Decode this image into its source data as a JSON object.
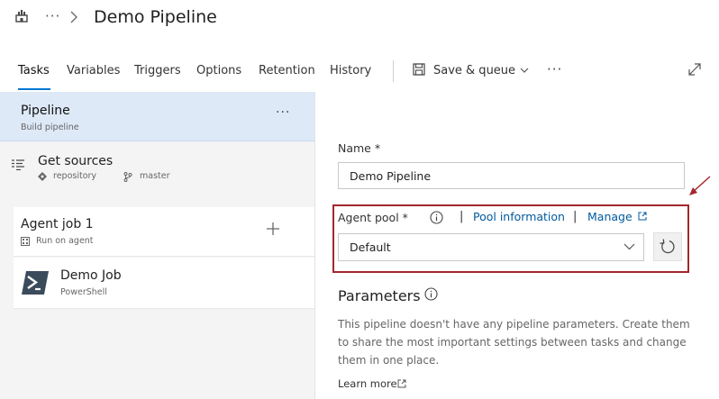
{
  "header": {
    "breadcrumb_more": "···",
    "title": "Demo Pipeline"
  },
  "tabs": [
    {
      "label": "Tasks",
      "active": true
    },
    {
      "label": "Variables"
    },
    {
      "label": "Triggers"
    },
    {
      "label": "Options"
    },
    {
      "label": "Retention"
    },
    {
      "label": "History"
    }
  ],
  "toolbar": {
    "save_queue_label": "Save & queue",
    "more": "···"
  },
  "pipeline": {
    "title": "Pipeline",
    "subtitle": "Build pipeline",
    "more": "···"
  },
  "get_sources": {
    "title": "Get sources",
    "repo": "repository",
    "branch": "master"
  },
  "agent_job": {
    "title": "Agent job 1",
    "subtitle": "Run on agent"
  },
  "task": {
    "title": "Demo Job",
    "subtitle": "PowerShell"
  },
  "form": {
    "name_label": "Name *",
    "name_value": "Demo Pipeline",
    "agent_pool_label": "Agent pool *",
    "separator": "|",
    "pool_info_link": "Pool information",
    "manage_link": "Manage",
    "agent_pool_value": "Default"
  },
  "parameters": {
    "title": "Parameters",
    "description": "This pipeline doesn't have any pipeline parameters. Create them to share the most important settings between tasks and change them in one place.",
    "learn_more": "Learn more"
  },
  "colors": {
    "accent": "#0078d4",
    "link": "#005a9e",
    "highlight_box": "#a4262c",
    "selected_card": "#dee9f7"
  }
}
